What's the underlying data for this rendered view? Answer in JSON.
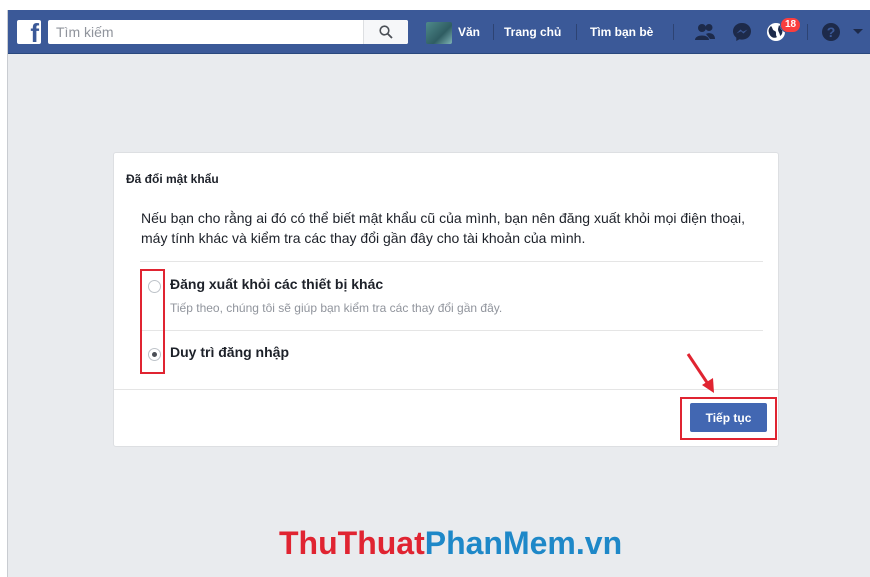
{
  "topbar": {
    "search_placeholder": "Tìm kiếm",
    "user_name": "Văn",
    "nav_home": "Trang chủ",
    "nav_find_friends": "Tìm bạn bè",
    "notifications_count": "18"
  },
  "dialog": {
    "title": "Đã đổi mật khẩu",
    "body": "Nếu bạn cho rằng ai đó có thể biết mật khẩu cũ của mình, bạn nên đăng xuất khỏi mọi điện thoại, máy tính khác và kiểm tra các thay đổi gần đây cho tài khoản của mình.",
    "options": [
      {
        "label": "Đăng xuất khỏi các thiết bị khác",
        "sub": "Tiếp theo, chúng tôi sẽ giúp bạn kiểm tra các thay đổi gần đây.",
        "selected": false
      },
      {
        "label": "Duy trì đăng nhập",
        "sub": "",
        "selected": true
      }
    ],
    "continue_label": "Tiếp tục"
  },
  "watermark": {
    "part1": "ThuThuat",
    "part2": "PhanMem",
    "part3": ".vn",
    "color_red": "#e02431",
    "color_blue": "#1e88c8"
  },
  "colors": {
    "facebook_blue": "#3b5998",
    "button_blue": "#4267b2",
    "highlight_red": "#e02431"
  },
  "icons": [
    "facebook-logo-icon",
    "search-icon",
    "friends-icon",
    "messenger-icon",
    "notifications-globe-icon",
    "help-icon",
    "caret-down-icon",
    "annotation-arrow-icon"
  ]
}
